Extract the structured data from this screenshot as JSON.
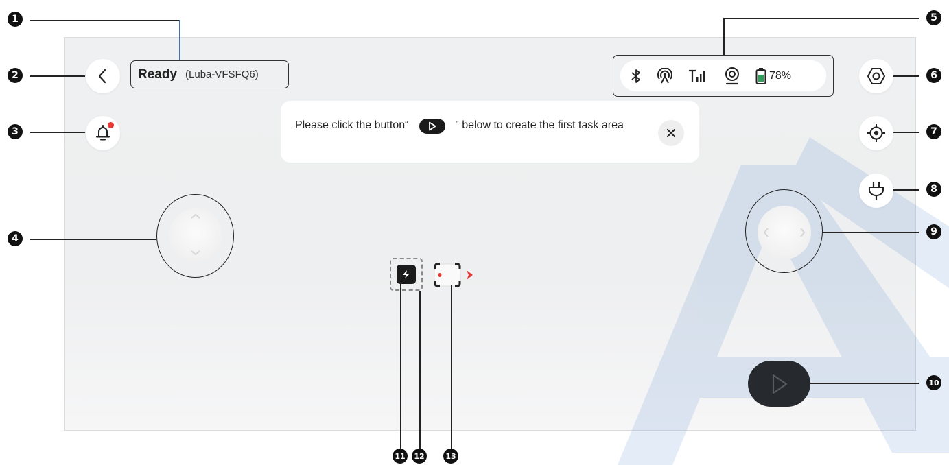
{
  "status": {
    "state": "Ready",
    "device": "(Luba-VFSFQ6)"
  },
  "connectivity": {
    "icons": [
      "bluetooth-icon",
      "rtk-antenna-icon",
      "cellular-signal-icon",
      "camera-icon",
      "battery-icon"
    ],
    "battery_percent": "78%",
    "battery_level": 0.78
  },
  "toast": {
    "message_before": "Please click the button“",
    "message_after": "” below to create the first task area"
  },
  "callouts": [
    "1",
    "2",
    "3",
    "4",
    "5",
    "6",
    "7",
    "8",
    "9",
    "10",
    "11",
    "12",
    "13"
  ],
  "colors": {
    "accent_red": "#e53935",
    "play_button": "#26292d",
    "battery_fill": "#2e9e5b",
    "watermark": "#2f72c4"
  }
}
